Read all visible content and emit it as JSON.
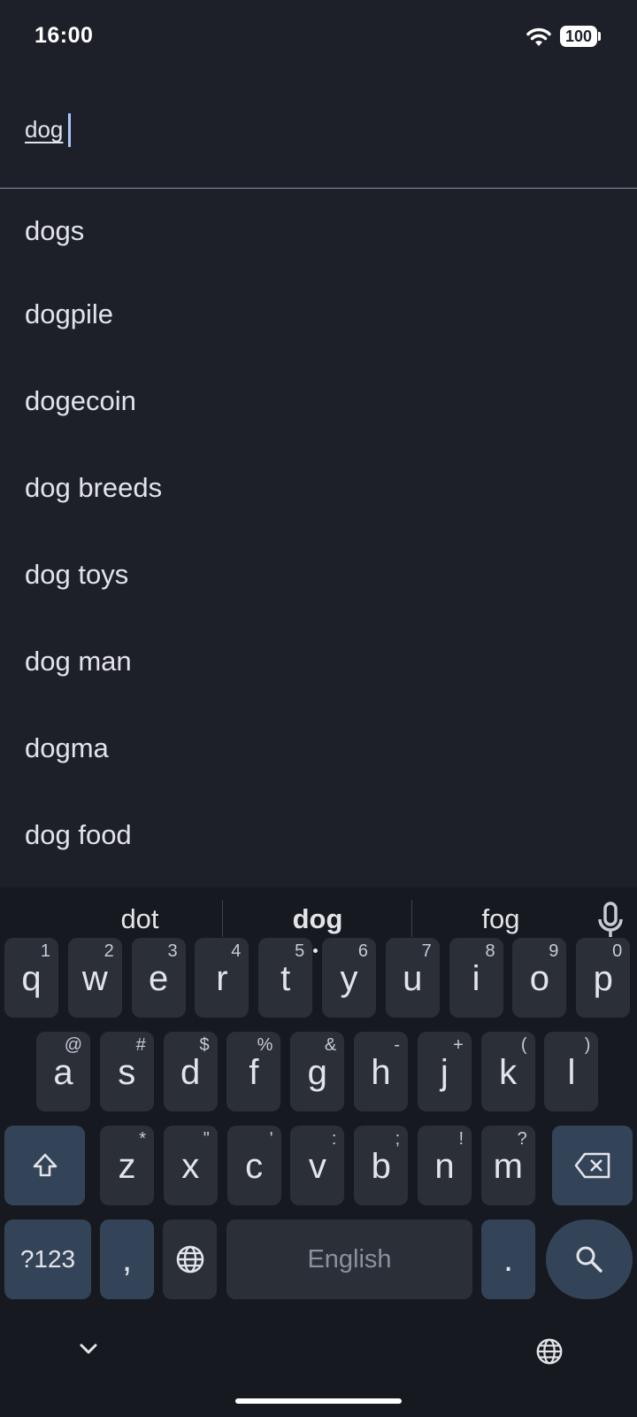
{
  "status_bar": {
    "time": "16:00",
    "battery": "100"
  },
  "search": {
    "query": "dog"
  },
  "suggestions": [
    "dogs",
    "dogpile",
    "dogecoin",
    "dog breeds",
    "dog toys",
    "dog man",
    "dogma",
    "dog food"
  ],
  "keyboard": {
    "candidates": [
      "dot",
      "dog",
      "fog"
    ],
    "row1": [
      {
        "k": "q",
        "h": "1"
      },
      {
        "k": "w",
        "h": "2"
      },
      {
        "k": "e",
        "h": "3"
      },
      {
        "k": "r",
        "h": "4"
      },
      {
        "k": "t",
        "h": "5"
      },
      {
        "k": "y",
        "h": "6"
      },
      {
        "k": "u",
        "h": "7"
      },
      {
        "k": "i",
        "h": "8"
      },
      {
        "k": "o",
        "h": "9"
      },
      {
        "k": "p",
        "h": "0"
      }
    ],
    "row2": [
      {
        "k": "a",
        "h": "@"
      },
      {
        "k": "s",
        "h": "#"
      },
      {
        "k": "d",
        "h": "$"
      },
      {
        "k": "f",
        "h": "%"
      },
      {
        "k": "g",
        "h": "&"
      },
      {
        "k": "h",
        "h": "-"
      },
      {
        "k": "j",
        "h": "+"
      },
      {
        "k": "k",
        "h": "("
      },
      {
        "k": "l",
        "h": ")"
      }
    ],
    "row3": [
      {
        "k": "z",
        "h": "*"
      },
      {
        "k": "x",
        "h": "\""
      },
      {
        "k": "c",
        "h": "'"
      },
      {
        "k": "v",
        "h": ":"
      },
      {
        "k": "b",
        "h": ";"
      },
      {
        "k": "n",
        "h": "!"
      },
      {
        "k": "m",
        "h": "?"
      }
    ],
    "symbols_label": "?123",
    "comma": ",",
    "space_label": "English",
    "period": "."
  }
}
